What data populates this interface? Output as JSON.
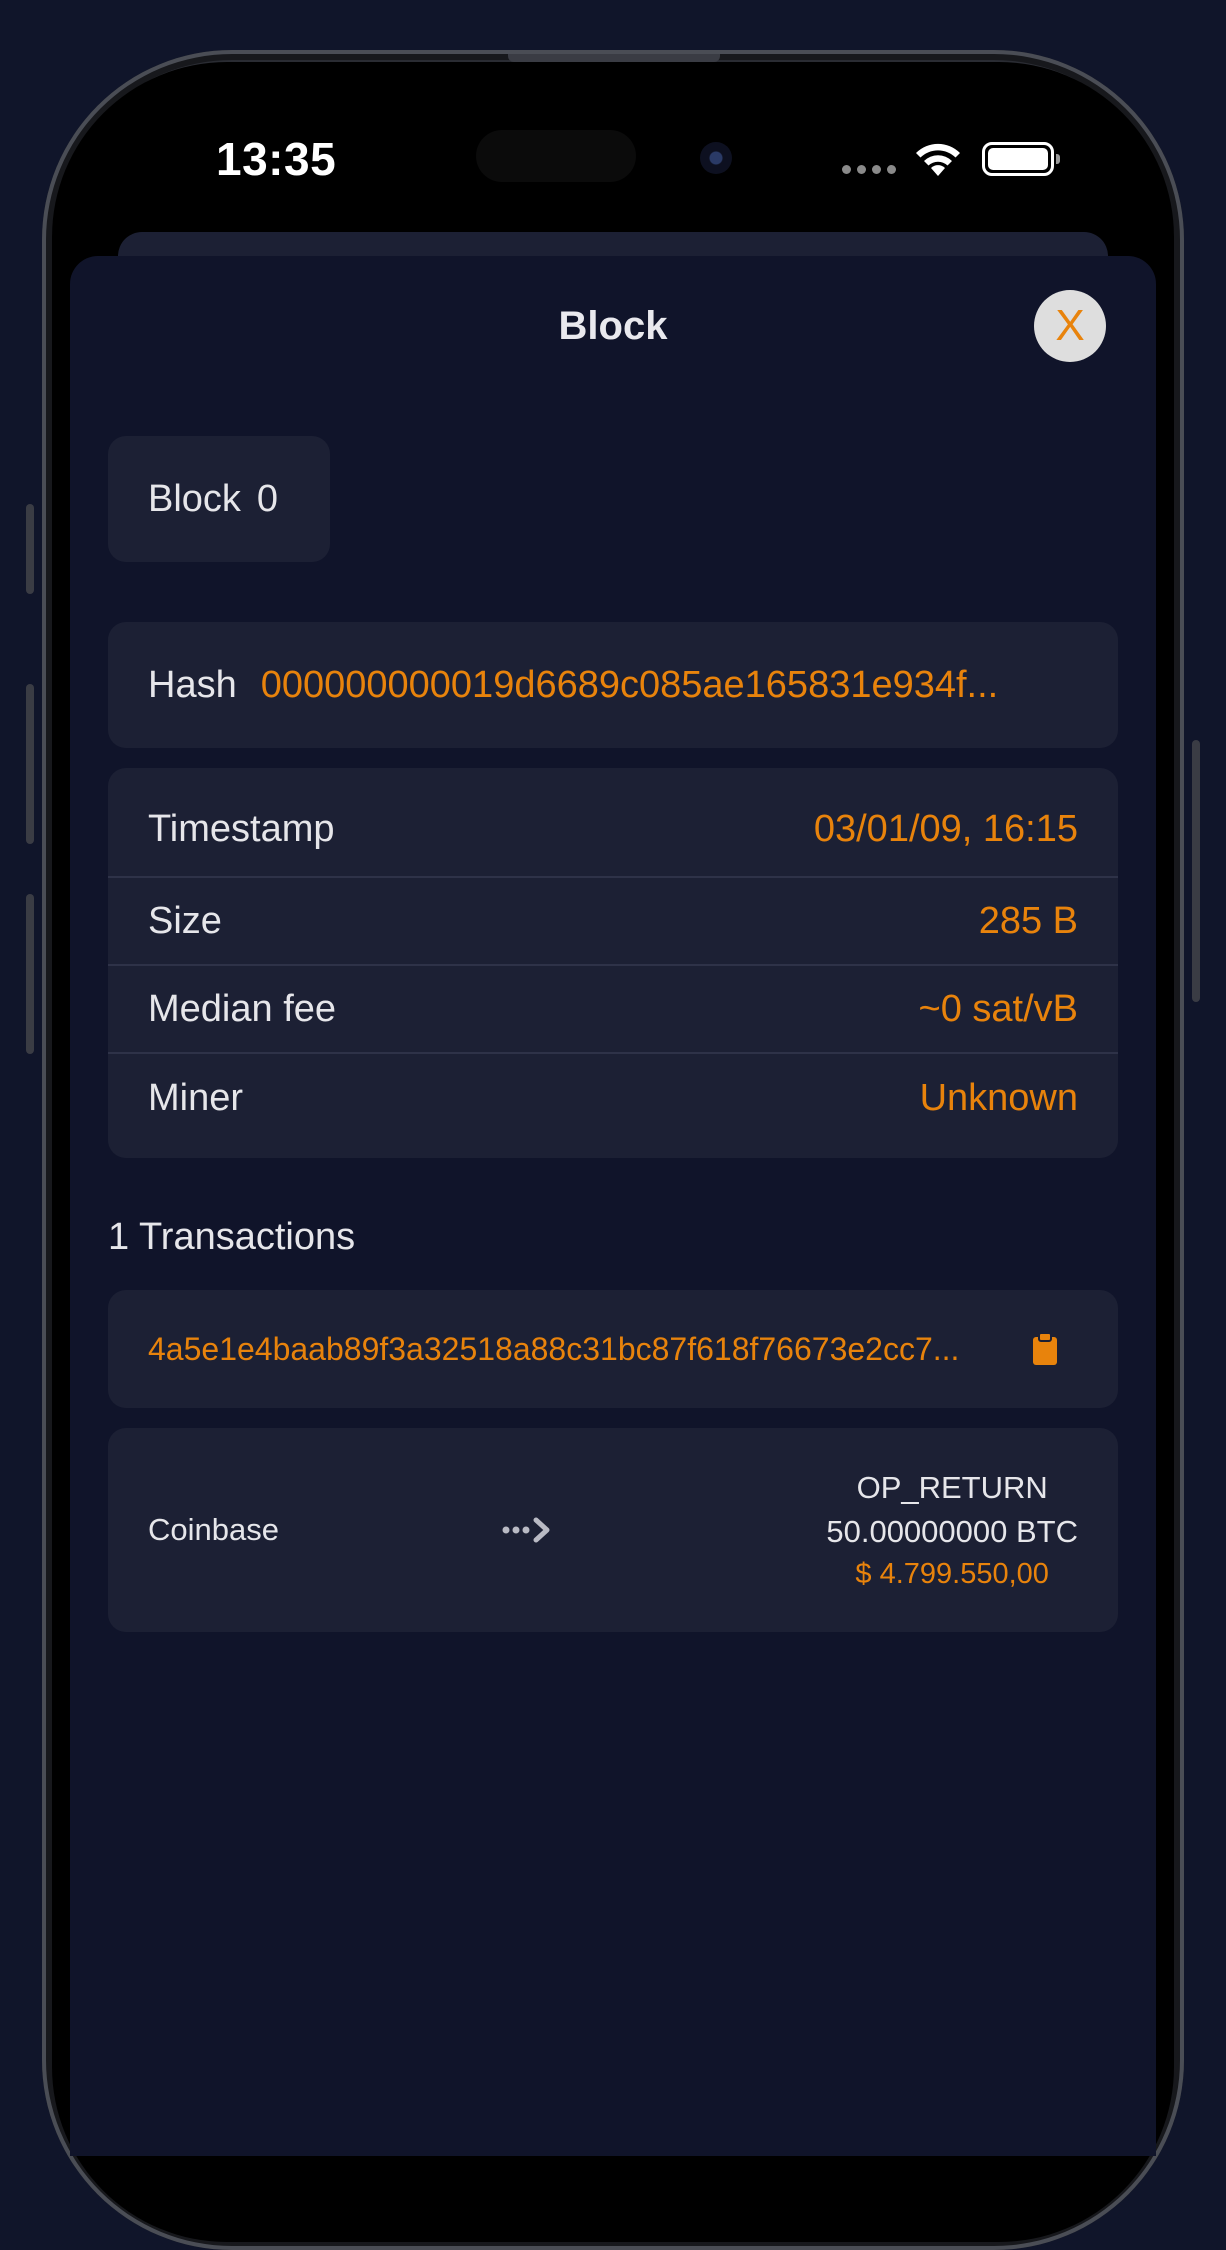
{
  "status_bar": {
    "time": "13:35"
  },
  "sheet": {
    "title": "Block",
    "close_label": "X"
  },
  "block": {
    "label": "Block",
    "height": "0"
  },
  "hash": {
    "label": "Hash",
    "value": "000000000019d6689c085ae165831e934f..."
  },
  "details": [
    {
      "label": "Timestamp",
      "value": "03/01/09, 16:15"
    },
    {
      "label": "Size",
      "value": "285 B"
    },
    {
      "label": "Median fee",
      "value": "~0 sat/vB"
    },
    {
      "label": "Miner",
      "value": "Unknown"
    }
  ],
  "transactions": {
    "heading": "1 Transactions",
    "items": [
      {
        "txid": "4a5e1e4baab89f3a32518a88c31bc87f618f76673e2cc7...",
        "input": "Coinbase",
        "output_address": "OP_RETURN",
        "output_amount": "50.00000000 BTC",
        "output_fiat": "$ 4.799.550,00"
      }
    ]
  },
  "colors": {
    "accent": "#e8830c",
    "background": "#10142a",
    "card": "#1c2034",
    "text": "#e6e6ea"
  },
  "icons": {
    "close": "close-icon",
    "copy": "clipboard-icon",
    "flow": "dotted-arrow-right-icon",
    "wifi": "wifi-icon",
    "battery": "battery-icon",
    "signal": "signal-dots-icon"
  }
}
